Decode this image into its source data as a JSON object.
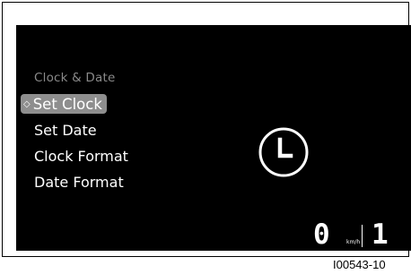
{
  "menu": {
    "title": "Clock & Date",
    "selected_icon": "◇",
    "items": [
      {
        "label": "Set Clock",
        "selected": true
      },
      {
        "label": "Set Date",
        "selected": false
      },
      {
        "label": "Clock Format",
        "selected": false
      },
      {
        "label": "Date Format",
        "selected": false
      }
    ]
  },
  "status": {
    "speed": "0",
    "speed_unit": "km/h",
    "gear": "1"
  },
  "figure_ref": "I00543-10",
  "icons": {
    "center": "clock-icon",
    "selection": "diamond-icon"
  },
  "colors": {
    "screen_bg": "#000000",
    "highlight": "#8e8e8e",
    "title_text": "#8a8a8a",
    "text": "#ffffff"
  }
}
